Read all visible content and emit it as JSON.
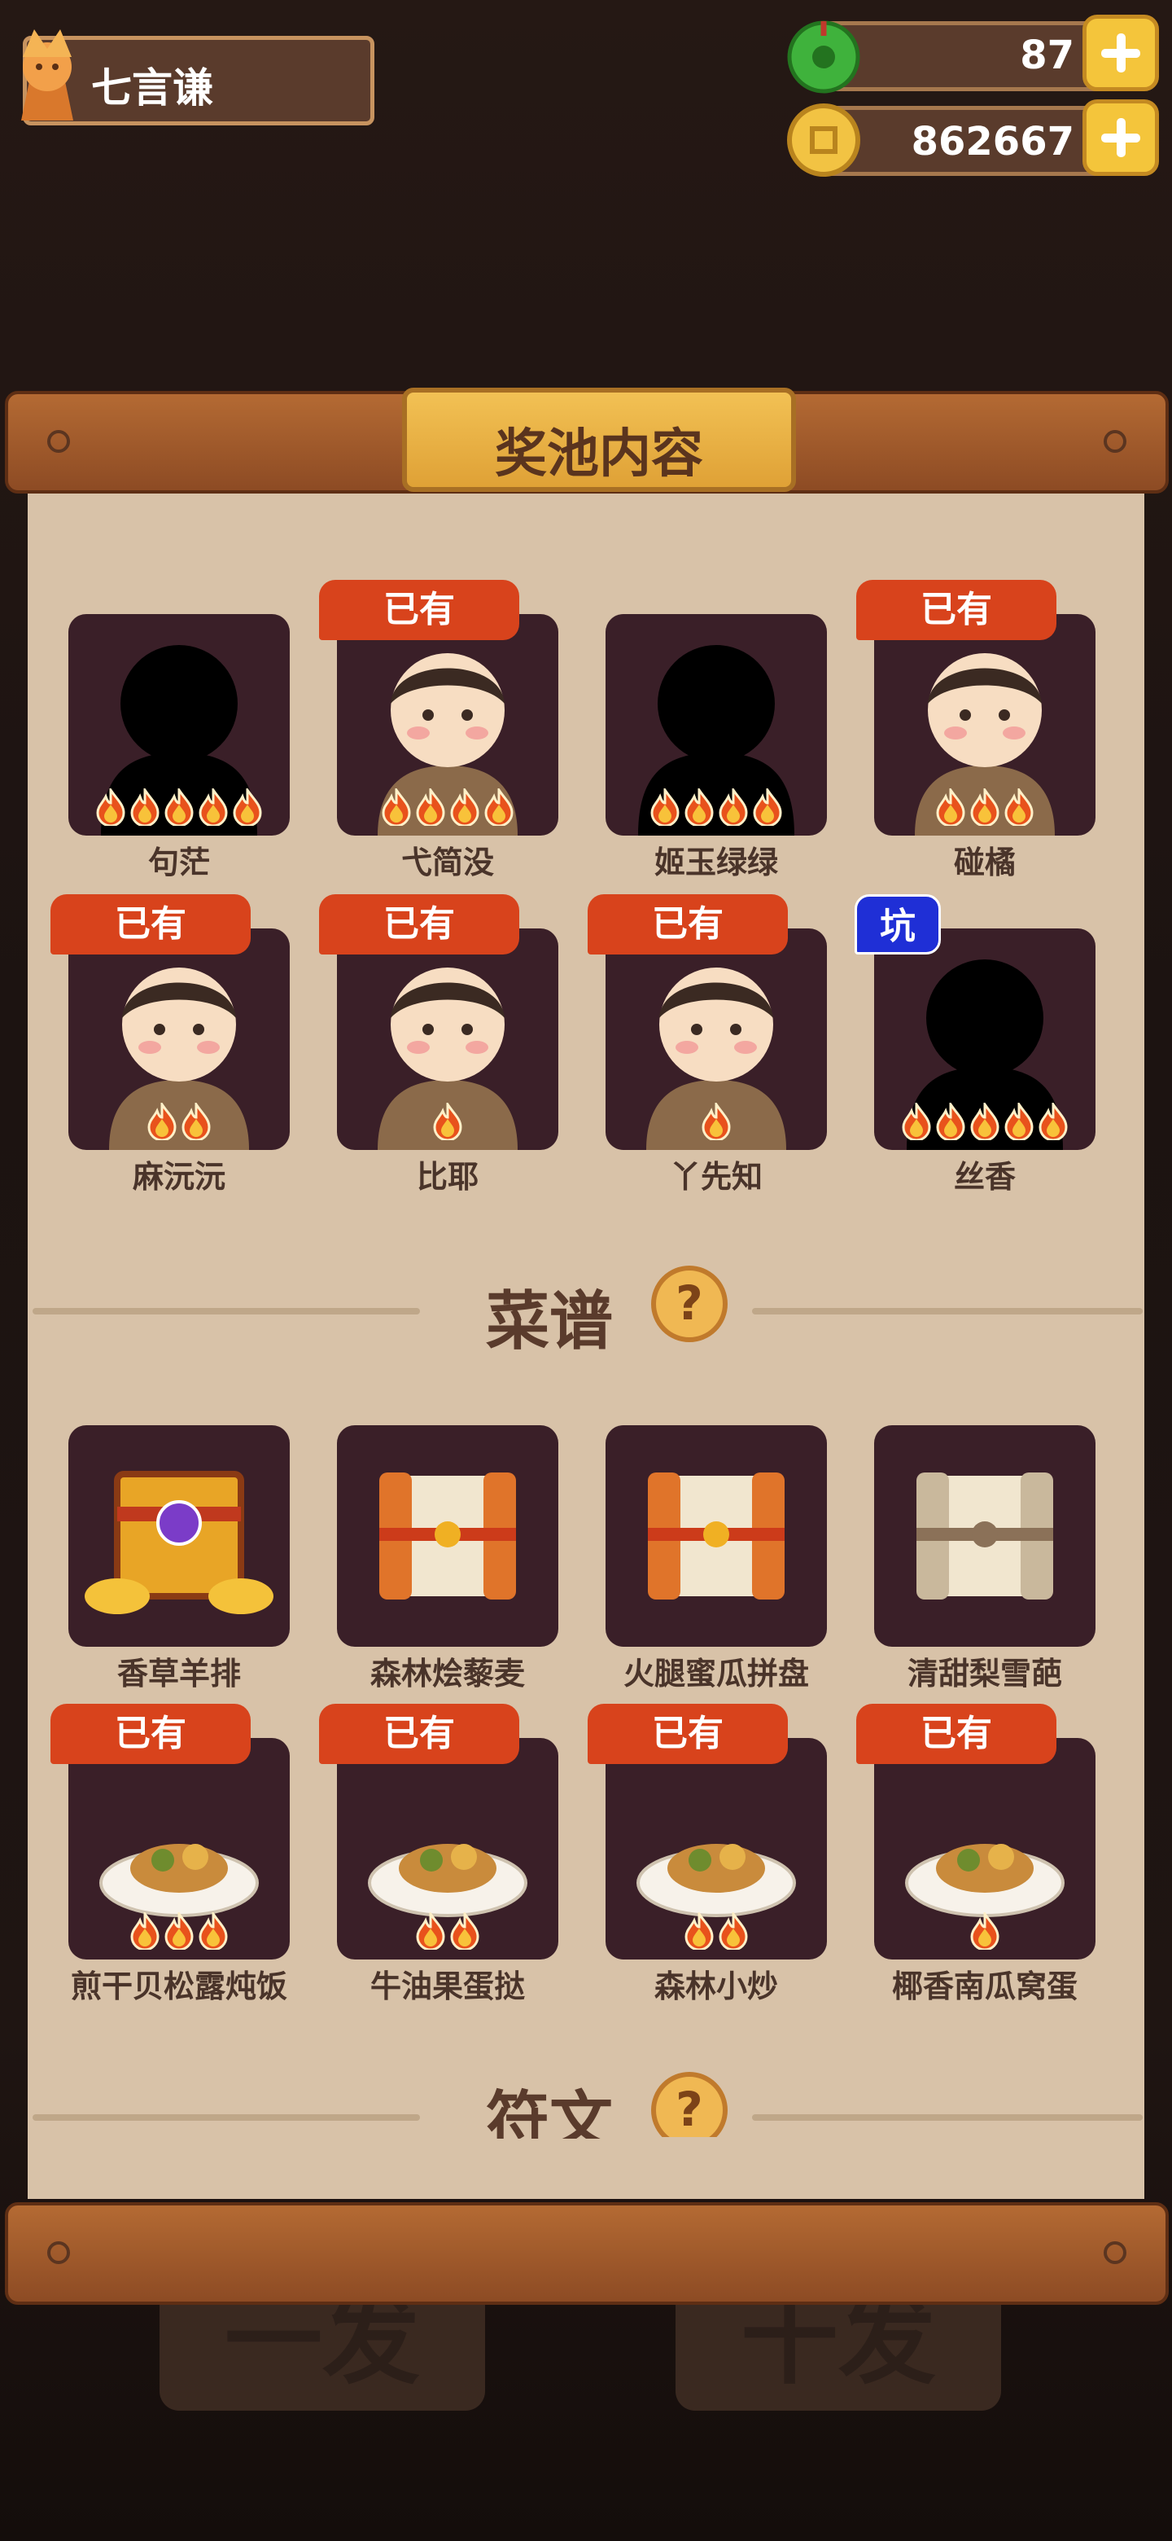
{
  "user": {
    "name": "七言谦"
  },
  "resources": {
    "jade": "87",
    "coins": "862667"
  },
  "background_buttons": {
    "single": "一发",
    "ten": "十发"
  },
  "panel": {
    "title": "奖池内容"
  },
  "status": {
    "owned": "已有",
    "pit": "坑"
  },
  "characters": [
    {
      "name": "句茫",
      "stars": 5,
      "owned": false,
      "silhouette": true
    },
    {
      "name": "弋简没",
      "stars": 4,
      "owned": true,
      "silhouette": false
    },
    {
      "name": "姬玉绿绿",
      "stars": 4,
      "owned": false,
      "silhouette": true
    },
    {
      "name": "碰橘",
      "stars": 3,
      "owned": true,
      "silhouette": false
    },
    {
      "name": "麻沅沅",
      "stars": 2,
      "owned": true,
      "silhouette": false
    },
    {
      "name": "比耶",
      "stars": 1,
      "owned": true,
      "silhouette": false
    },
    {
      "name": "丫先知",
      "stars": 1,
      "owned": true,
      "silhouette": false
    },
    {
      "name": "丝香",
      "stars": 5,
      "owned": false,
      "silhouette": true,
      "pit": true
    }
  ],
  "recipes_section": {
    "title": "菜谱"
  },
  "recipes": [
    {
      "name": "香草羊排",
      "stars": 0,
      "owned": false,
      "icon": "divine-treasure-chest-icon"
    },
    {
      "name": "森林烩藜麦",
      "stars": 0,
      "owned": false,
      "icon": "recipe-scroll-icon"
    },
    {
      "name": "火腿蜜瓜拼盘",
      "stars": 0,
      "owned": false,
      "icon": "recipe-scroll-icon"
    },
    {
      "name": "清甜梨雪葩",
      "stars": 0,
      "owned": false,
      "icon": "plain-scroll-icon"
    },
    {
      "name": "煎干贝松露炖饭",
      "stars": 3,
      "owned": true,
      "icon": "risotto-dish-icon"
    },
    {
      "name": "牛油果蛋挞",
      "stars": 2,
      "owned": true,
      "icon": "egg-tart-dish-icon"
    },
    {
      "name": "森林小炒",
      "stars": 2,
      "owned": true,
      "icon": "stir-fry-box-icon"
    },
    {
      "name": "椰香南瓜窝蛋",
      "stars": 1,
      "owned": true,
      "icon": "pumpkin-egg-dish-icon"
    }
  ],
  "runes_section": {
    "title": "符文"
  },
  "colors": {
    "accent_orange": "#d8431c",
    "pit_blue": "#1f2fd6",
    "paper": "#d8c2a8",
    "card": "#3a1f28"
  }
}
